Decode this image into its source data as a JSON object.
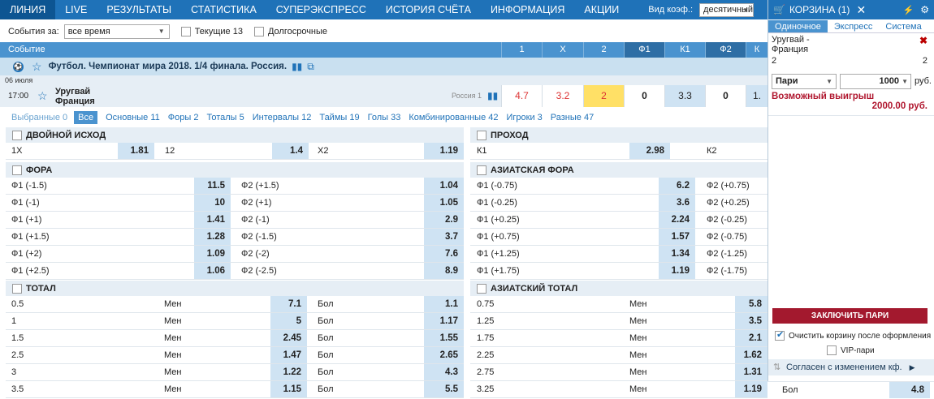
{
  "nav": {
    "items": [
      "ЛИНИЯ",
      "LIVE",
      "РЕЗУЛЬТАТЫ",
      "СТАТИСТИКА",
      "СУПЕРЭКСПРЕСС",
      "ИСТОРИЯ СЧЁТА",
      "ИНФОРМАЦИЯ",
      "АКЦИИ"
    ],
    "active_index": 0,
    "coef_label": "Вид коэф.:",
    "coef_value": "десятичный"
  },
  "filter": {
    "label": "События за:",
    "period": "все время",
    "current_label": "Текущие 13",
    "longterm_label": "Долгосрочные"
  },
  "event_header": {
    "title": "Событие",
    "columns": [
      "1",
      "X",
      "2",
      "Ф1",
      "К1",
      "Ф2",
      "К"
    ]
  },
  "league": {
    "title": "Футбол. Чемпионат мира 2018. 1/4 финала. Россия."
  },
  "date": "06 июля",
  "match": {
    "time": "17:00",
    "team1": "Уругвай",
    "team2": "Франция",
    "source": "Россия 1",
    "odds": [
      "4.7",
      "3.2",
      "2",
      "0",
      "3.3",
      "0",
      "1."
    ]
  },
  "market_tabs": {
    "chosen": "Выбранные 0",
    "all": "Все",
    "tabs": [
      "Основные 11",
      "Форы 2",
      "Тоталы 5",
      "Интервалы 12",
      "Таймы 19",
      "Голы 33",
      "Комбинированные 42",
      "Игроки 3",
      "Разные 47"
    ]
  },
  "markets": {
    "double": {
      "title": "ДВОЙНОЙ ИСХОД",
      "row": [
        {
          "label": "1X",
          "odd": "1.81"
        },
        {
          "label": "12",
          "odd": "1.4"
        },
        {
          "label": "X2",
          "odd": "1.19"
        }
      ]
    },
    "pass": {
      "title": "ПРОХОД",
      "row": [
        {
          "label": "К1",
          "odd": "2.98"
        },
        {
          "label": "К2",
          "odd": ""
        }
      ]
    },
    "fora": {
      "title": "ФОРА",
      "rows": [
        {
          "l1": "Ф1 (-1.5)",
          "o1": "11.5",
          "l2": "Ф2 (+1.5)",
          "o2": "1.04"
        },
        {
          "l1": "Ф1 (-1)",
          "o1": "10",
          "l2": "Ф2 (+1)",
          "o2": "1.05"
        },
        {
          "l1": "Ф1 (+1)",
          "o1": "1.41",
          "l2": "Ф2 (-1)",
          "o2": "2.9"
        },
        {
          "l1": "Ф1 (+1.5)",
          "o1": "1.28",
          "l2": "Ф2 (-1.5)",
          "o2": "3.7"
        },
        {
          "l1": "Ф1 (+2)",
          "o1": "1.09",
          "l2": "Ф2 (-2)",
          "o2": "7.6"
        },
        {
          "l1": "Ф1 (+2.5)",
          "o1": "1.06",
          "l2": "Ф2 (-2.5)",
          "o2": "8.9"
        }
      ]
    },
    "asian_fora": {
      "title": "АЗИАТСКАЯ ФОРА",
      "rows": [
        {
          "l1": "Ф1 (-0.75)",
          "o1": "6.2",
          "l2": "Ф2 (+0.75)"
        },
        {
          "l1": "Ф1 (-0.25)",
          "o1": "3.6",
          "l2": "Ф2 (+0.25)"
        },
        {
          "l1": "Ф1 (+0.25)",
          "o1": "2.24",
          "l2": "Ф2 (-0.25)"
        },
        {
          "l1": "Ф1 (+0.75)",
          "o1": "1.57",
          "l2": "Ф2 (-0.75)"
        },
        {
          "l1": "Ф1 (+1.25)",
          "o1": "1.34",
          "l2": "Ф2 (-1.25)"
        },
        {
          "l1": "Ф1 (+1.75)",
          "o1": "1.19",
          "l2": "Ф2 (-1.75)"
        }
      ]
    },
    "total": {
      "title": "ТОТАЛ",
      "under_label": "Мен",
      "over_label": "Бол",
      "rows": [
        {
          "line": "0.5",
          "under": "7.1",
          "over": "1.1"
        },
        {
          "line": "1",
          "under": "5",
          "over": "1.17"
        },
        {
          "line": "1.5",
          "under": "2.45",
          "over": "1.55"
        },
        {
          "line": "2.5",
          "under": "1.47",
          "over": "2.65"
        },
        {
          "line": "3",
          "under": "1.22",
          "over": "4.3"
        },
        {
          "line": "3.5",
          "under": "1.15",
          "over": "5.5"
        }
      ]
    },
    "asian_total": {
      "title": "АЗИАТСКИЙ ТОТАЛ",
      "under_label": "Мен",
      "over_label": "Бол",
      "rows": [
        {
          "line": "0.75",
          "under": "5.8"
        },
        {
          "line": "1.25",
          "under": "3.5"
        },
        {
          "line": "1.75",
          "under": "2.1"
        },
        {
          "line": "2.25",
          "under": "1.62"
        },
        {
          "line": "2.75",
          "under": "1.31"
        },
        {
          "line": "3.25",
          "under": "1.19",
          "over": "4.8"
        }
      ]
    }
  },
  "cart": {
    "title": "КОРЗИНА (1)",
    "tabs": [
      "Одиночное",
      "Экспресс",
      "Система"
    ],
    "bet_teams": "Уругвай -\nФранция",
    "bet_selection": "2",
    "bet_odd": "2",
    "bet_type": "Пари",
    "stake": "1000",
    "currency": "руб.",
    "win_label": "Возможный выигрыш",
    "win_amount": "2000.00 руб.",
    "place_button": "ЗАКЛЮЧИТЬ ПАРИ",
    "clear_label": "Очистить корзину после оформления",
    "vip_label": "VIP-пари",
    "agree_label": "Согласен с изменением кф."
  },
  "colors": {
    "nav_bg": "#1f72b8",
    "header_bg": "#4a93cf",
    "odd_bg": "#cfe3f3",
    "selected_odd": "#ffe066",
    "place_button": "#a3192e",
    "win_text": "#b0172f"
  }
}
